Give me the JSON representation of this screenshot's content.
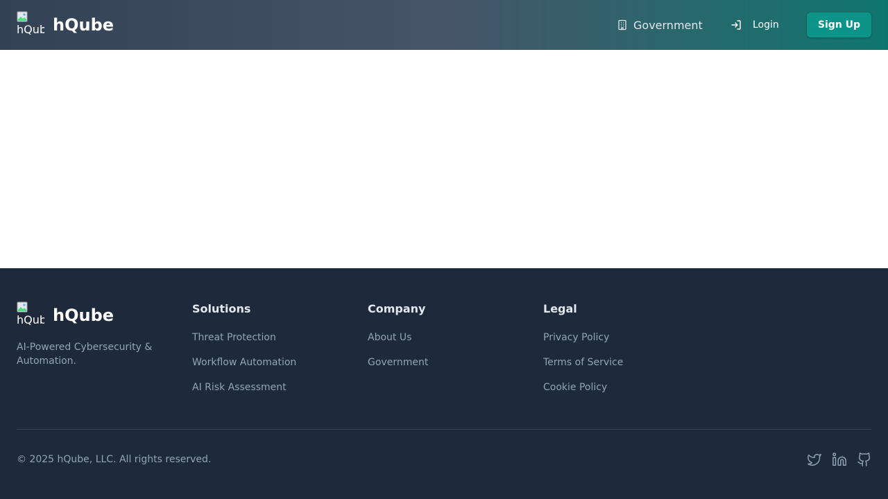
{
  "header": {
    "logo_alt": "hQube",
    "brand_name": "hQube",
    "nav": {
      "government": "Government",
      "login": "Login",
      "signup": "Sign Up"
    }
  },
  "footer": {
    "logo_alt": "hQube",
    "brand_name": "hQube",
    "tagline": "AI-Powered Cybersecurity & Automation.",
    "columns": [
      {
        "title": "Solutions",
        "links": [
          "Threat Protection",
          "Workflow Automation",
          "AI Risk Assessment"
        ]
      },
      {
        "title": "Company",
        "links": [
          "About Us",
          "Government"
        ]
      },
      {
        "title": "Legal",
        "links": [
          "Privacy Policy",
          "Terms of Service",
          "Cookie Policy"
        ]
      }
    ],
    "copyright": "© 2025 hQube, LLC. All rights reserved.",
    "socials": [
      "twitter-icon",
      "linkedin-icon",
      "github-icon"
    ]
  },
  "colors": {
    "header_gradient_start": "#334155",
    "header_gradient_mid": "#475569",
    "header_gradient_end": "#0f766e",
    "accent": "#0d9488",
    "footer_bg": "#1e293b",
    "footer_text": "#94a3b8"
  }
}
